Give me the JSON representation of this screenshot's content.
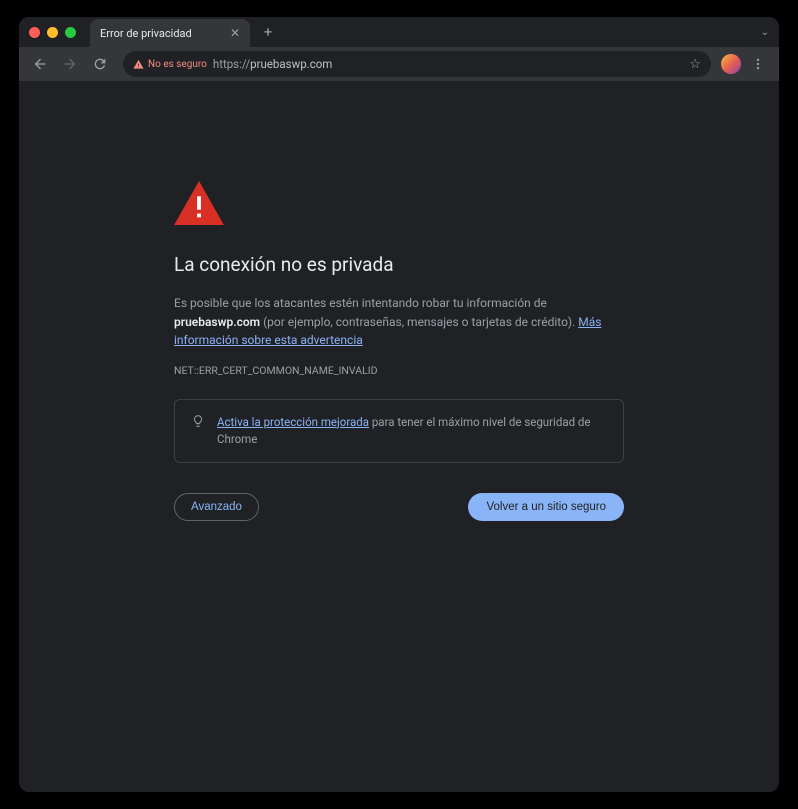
{
  "tab": {
    "title": "Error de privacidad"
  },
  "omnibox": {
    "not_secure_label": "No es seguro",
    "protocol": "https://",
    "url_host": "pruebaswp.com"
  },
  "page": {
    "heading": "La conexión no es privada",
    "body_prefix": "Es posible que los atacantes estén intentando robar tu información de ",
    "body_domain": "pruebaswp.com",
    "body_suffix": " (por ejemplo, contraseñas, mensajes o tarjetas de crédito). ",
    "learn_more": "Más información sobre esta advertencia",
    "error_code": "NET::ERR_CERT_COMMON_NAME_INVALID",
    "promo_link": "Activa la protección mejorada",
    "promo_suffix": " para tener el máximo nivel de seguridad de Chrome",
    "advanced_button": "Avanzado",
    "safe_button": "Volver a un sitio seguro"
  }
}
